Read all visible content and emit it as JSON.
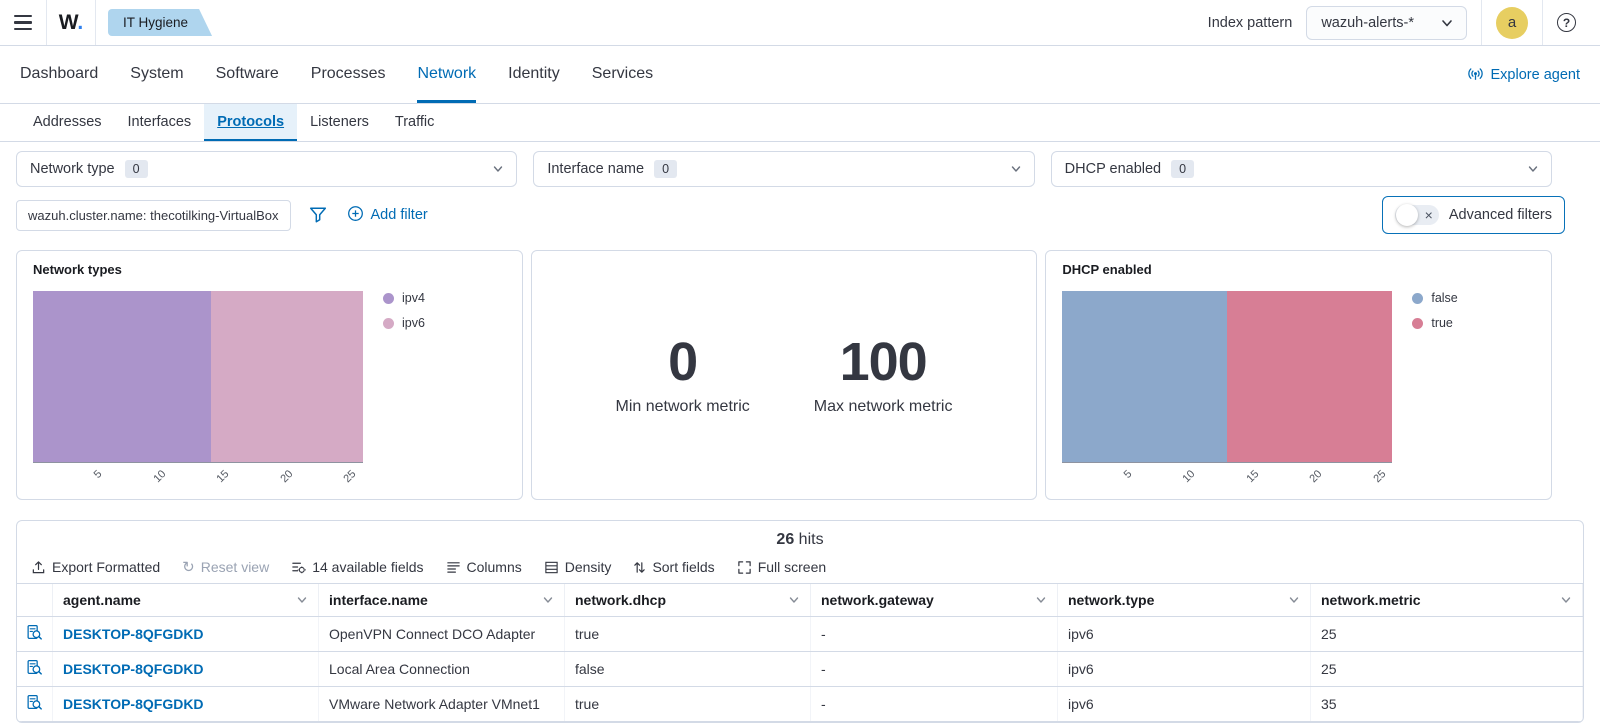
{
  "colors": {
    "accent": "#006BB4"
  },
  "header": {
    "logo_text": "W",
    "logo_dot": ".",
    "app_badge": "IT Hygiene",
    "index_pattern_label": "Index pattern",
    "index_pattern_value": "wazuh-alerts-*",
    "avatar_initial": "a"
  },
  "tabs": {
    "items": [
      "Dashboard",
      "System",
      "Software",
      "Processes",
      "Network",
      "Identity",
      "Services"
    ],
    "active": "Network",
    "explore_agent": "Explore agent"
  },
  "subtabs": {
    "items": [
      "Addresses",
      "Interfaces",
      "Protocols",
      "Listeners",
      "Traffic"
    ],
    "active": "Protocols"
  },
  "filters": {
    "selects": [
      {
        "label": "Network type",
        "count": "0"
      },
      {
        "label": "Interface name",
        "count": "0"
      },
      {
        "label": "DHCP enabled",
        "count": "0"
      }
    ],
    "pill": "wazuh.cluster.name: thecotilking-VirtualBox",
    "add_filter_label": "Add filter",
    "advanced_filters_label": "Advanced filters"
  },
  "chart_data": [
    {
      "type": "bar",
      "subtype": "horizontal-stacked",
      "title": "Network types",
      "series": [
        {
          "name": "ipv4",
          "value": 14,
          "color": "#AB94CB"
        },
        {
          "name": "ipv6",
          "value": 12,
          "color": "#D5AAC5"
        }
      ],
      "total": 26,
      "xlim": [
        0,
        26
      ],
      "x_ticks": [
        5,
        10,
        15,
        20,
        25
      ],
      "legend_position": "right"
    },
    {
      "type": "metric",
      "metrics": [
        {
          "value": "0",
          "label": "Min network metric"
        },
        {
          "value": "100",
          "label": "Max network metric"
        }
      ]
    },
    {
      "type": "bar",
      "subtype": "horizontal-stacked",
      "title": "DHCP enabled",
      "series": [
        {
          "name": "false",
          "value": 13,
          "color": "#8CA8CB"
        },
        {
          "name": "true",
          "value": 13,
          "color": "#D77E95"
        }
      ],
      "total": 26,
      "xlim": [
        0,
        26
      ],
      "x_ticks": [
        5,
        10,
        15,
        20,
        25
      ],
      "legend_position": "right"
    }
  ],
  "table": {
    "hits_count": "26",
    "hits_label": "hits",
    "toolbar": [
      {
        "label": "Export Formatted",
        "icon": "export-icon",
        "disabled": false
      },
      {
        "label": "Reset view",
        "icon": "reset-icon",
        "disabled": true
      },
      {
        "label": "14 available fields",
        "icon": "fields-icon",
        "disabled": false
      },
      {
        "label": "Columns",
        "icon": "columns-icon",
        "disabled": false
      },
      {
        "label": "Density",
        "icon": "density-icon",
        "disabled": false
      },
      {
        "label": "Sort fields",
        "icon": "sort-icon",
        "disabled": false
      },
      {
        "label": "Full screen",
        "icon": "fullscreen-icon",
        "disabled": false
      }
    ],
    "columns": [
      "agent.name",
      "interface.name",
      "network.dhcp",
      "network.gateway",
      "network.type",
      "network.metric"
    ],
    "rows": [
      {
        "agent": "DESKTOP-8QFGDKD",
        "interface": "OpenVPN Connect DCO Adapter",
        "dhcp": "true",
        "gateway": "-",
        "type": "ipv6",
        "metric": "25"
      },
      {
        "agent": "DESKTOP-8QFGDKD",
        "interface": "Local Area Connection",
        "dhcp": "false",
        "gateway": "-",
        "type": "ipv6",
        "metric": "25"
      },
      {
        "agent": "DESKTOP-8QFGDKD",
        "interface": "VMware Network Adapter VMnet1",
        "dhcp": "true",
        "gateway": "-",
        "type": "ipv6",
        "metric": "35"
      }
    ]
  }
}
